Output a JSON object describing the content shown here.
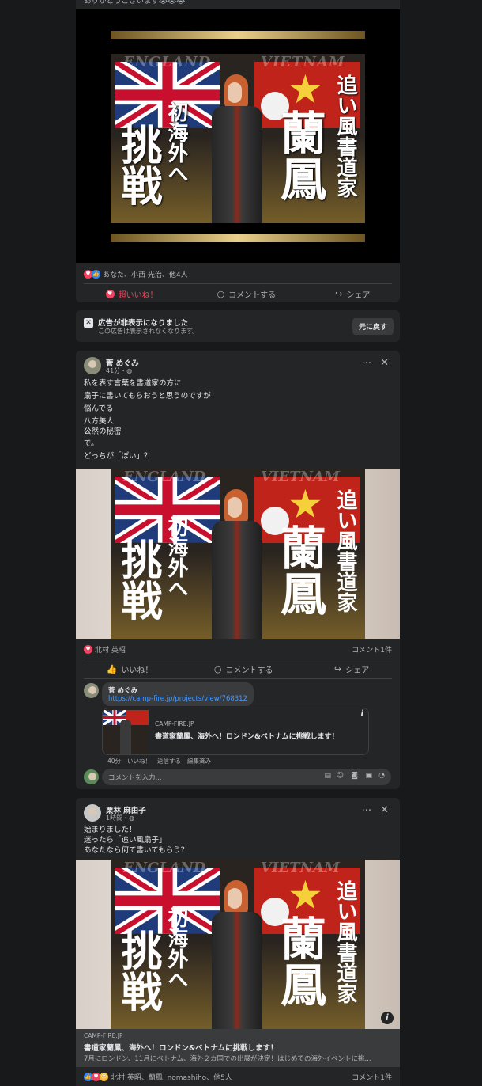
{
  "top_post": {
    "partial_text": "ありがとうございます😭😭😭",
    "reactions_text": "あなた、小西 光治、他4人",
    "actions": {
      "love": "超いいね！",
      "comment": "コメントする",
      "share": "シェア"
    }
  },
  "promo_image": {
    "label_left": "ENGLAND",
    "label_right": "VIETNAM",
    "text_challenge": "挑戦",
    "text_first_overseas": "初海外へ",
    "text_name": "蘭鳳",
    "text_profession": "追い風書道家"
  },
  "hidden_ad": {
    "title": "広告が非表示になりました",
    "subtitle": "この広告は表示されなくなります。",
    "undo_button": "元に戻す"
  },
  "post2": {
    "author": "菅 めぐみ",
    "time": "41分・",
    "lines": [
      "私を表す言葉を書道家の方に",
      "扇子に書いてもらおうと思うのですが",
      "悩んでる",
      "八方美人",
      "公然の秘密",
      "で。",
      "どっちが「ぽい」？"
    ],
    "reactions_text": "北村 英昭",
    "comment_count": "コメント1件",
    "actions": {
      "like": "いいね！",
      "comment": "コメントする",
      "share": "シェア"
    },
    "comment": {
      "author": "菅 めぐみ",
      "link": "https://camp-fire.jp/projects/view/768312",
      "preview_domain": "CAMP-FIRE.JP",
      "preview_title": "書道家蘭鳳、海外へ！ロンドン&ベトナムに挑戦します！",
      "meta_time": "40分",
      "meta_like": "いいね！",
      "meta_reply": "返信する",
      "meta_edited": "編集済み"
    },
    "comment_input_placeholder": "コメントを入力..."
  },
  "post3": {
    "author": "栗林 麻由子",
    "time": "1時間・",
    "lines": [
      "始まりました！",
      "迷ったら「追い風扇子」",
      "あなたなら何て書いてもらう？"
    ],
    "link_domain": "CAMP-FIRE.JP",
    "link_title": "書道家蘭鳳、海外へ！ロンドン&ベトナムに挑戦します！",
    "link_desc": "7月にロンドン、11月にベトナム、海外２カ国での出展が決定！はじめての海外イベントに挑...",
    "reactions_text": "北村 英昭、蘭鳳, nomashiho、他5人",
    "comment_count": "コメント1件"
  },
  "colors": {
    "bg": "#18191a",
    "card": "#242526",
    "love": "#f3425f",
    "link": "#4599ff"
  }
}
